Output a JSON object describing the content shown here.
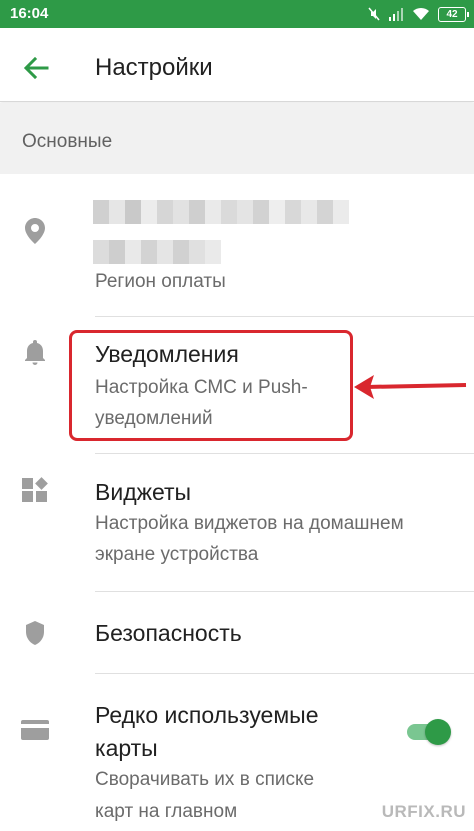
{
  "status_bar": {
    "time": "16:04",
    "battery": "42",
    "icons": [
      "mute-icon",
      "signal-icon",
      "wifi-icon",
      "battery-icon"
    ]
  },
  "app_bar": {
    "title": "Настройки",
    "back_icon": "arrow-left-icon"
  },
  "section": {
    "title": "Основные"
  },
  "rows": [
    {
      "icon": "location-pin-icon",
      "title": "",
      "subtitle": "Регион оплаты"
    },
    {
      "icon": "bell-icon",
      "title": "Уведомления",
      "subtitle_line1": "Настройка СМС и Push-",
      "subtitle_line2": "уведомлений"
    },
    {
      "icon": "widgets-icon",
      "title": "Виджеты",
      "subtitle_line1": "Настройка виджетов на домашнем",
      "subtitle_line2": "экране устройства"
    },
    {
      "icon": "shield-icon",
      "title": "Безопасность"
    },
    {
      "icon": "card-icon",
      "title_line1": "Редко используемые",
      "title_line2": "карты",
      "subtitle_line1": "Сворачивать их в списке",
      "subtitle_line2": "карт на главном",
      "toggle_on": true
    }
  ],
  "watermark": "URFIX.RU",
  "colors": {
    "primary": "#2e9a47",
    "highlight": "#d9272e",
    "icon_gray": "#9e9e9e"
  }
}
